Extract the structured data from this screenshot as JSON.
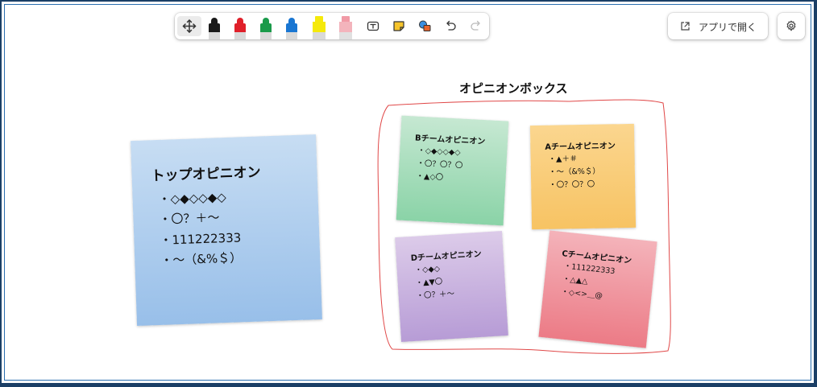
{
  "toolbar": {
    "tools": [
      {
        "name": "move-tool",
        "icon": "move-arrows-icon",
        "active": true
      },
      {
        "name": "pen-black",
        "icon": "pen-icon",
        "color": "#1a1a1a"
      },
      {
        "name": "pen-red",
        "icon": "pen-icon",
        "color": "#e0202a"
      },
      {
        "name": "pen-green",
        "icon": "pen-icon",
        "color": "#1a9a4a"
      },
      {
        "name": "pen-blue",
        "icon": "pen-icon",
        "color": "#1976d2"
      },
      {
        "name": "highlighter-yellow",
        "icon": "highlighter-icon",
        "color": "#f5e90a"
      },
      {
        "name": "eraser",
        "icon": "eraser-icon",
        "color": "#f19aa6"
      },
      {
        "name": "text-box",
        "icon": "text-box-icon"
      },
      {
        "name": "sticky-note",
        "icon": "sticky-note-icon",
        "color": "#f6c42b"
      },
      {
        "name": "shapes",
        "icon": "shapes-icon",
        "color": "#e8642c"
      },
      {
        "name": "undo",
        "icon": "undo-icon"
      },
      {
        "name": "redo",
        "icon": "redo-icon",
        "disabled": true
      }
    ]
  },
  "open_in_app": {
    "label": "アプリで開く",
    "icon": "open-external-icon"
  },
  "settings": {
    "icon": "gear-icon"
  },
  "canvas": {
    "box_title": "オピニオンボックス",
    "lasso_color": "#e04848",
    "notes": {
      "top": {
        "title": "トップオピニオン",
        "lines": [
          "・◇◆◇◇◆◇",
          "・〇？＋〜",
          "・111222333",
          "・〜（&%＄）"
        ],
        "color": "#aaccee"
      },
      "b": {
        "title": "Bチームオピニオン",
        "lines": [
          "・◇◆◇◇◆◇",
          "・〇？〇？〇",
          "・▲◇〇"
        ],
        "color": "#a6dcbb"
      },
      "a": {
        "title": "Aチームオピニオン",
        "lines": [
          "・▲＋＃",
          "・〜（&%＄）",
          "・〇？〇？〇"
        ],
        "color": "#f9cc74"
      },
      "d": {
        "title": "Dチームオピニオン",
        "lines": [
          "・◇◆◇",
          "・▲▼〇",
          "・〇？＋〜"
        ],
        "color": "#c9b2dd"
      },
      "c": {
        "title": "Cチームオピニオン",
        "lines": [
          "・111222333",
          "・△▲△",
          "・◇<>＿@"
        ],
        "color": "#ef949d"
      }
    }
  }
}
